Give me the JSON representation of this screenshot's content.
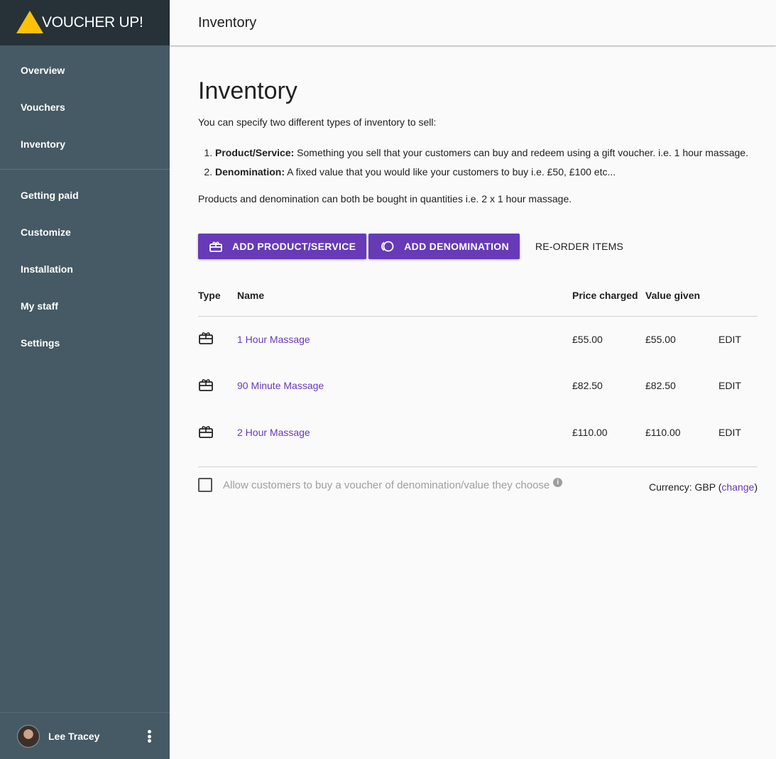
{
  "brand": {
    "name": "VOUCHER UP!"
  },
  "sidebar": {
    "items_top": [
      {
        "label": "Overview"
      },
      {
        "label": "Vouchers"
      },
      {
        "label": "Inventory"
      }
    ],
    "items_bottom": [
      {
        "label": "Getting paid"
      },
      {
        "label": "Customize"
      },
      {
        "label": "Installation"
      },
      {
        "label": "My staff"
      },
      {
        "label": "Settings"
      }
    ],
    "user": {
      "name": "Lee Tracey"
    }
  },
  "topbar": {
    "title": "Inventory"
  },
  "main": {
    "title": "Inventory",
    "intro": "You can specify two different types of inventory to sell:",
    "types": [
      {
        "term": "Product/Service:",
        "desc": " Something you sell that your customers can buy and redeem using a gift voucher. i.e. 1 hour massage."
      },
      {
        "term": "Denomination:",
        "desc": " A fixed value that you would like your customers to buy i.e. £50, £100 etc..."
      }
    ],
    "note": "Products and denomination can both be bought in quantities i.e. 2 x 1 hour massage.",
    "actions": {
      "add_product": "ADD PRODUCT/SERVICE",
      "add_denomination": "ADD DENOMINATION",
      "reorder": "RE-ORDER ITEMS"
    },
    "table": {
      "headers": {
        "type": "Type",
        "name": "Name",
        "price": "Price charged",
        "value": "Value given"
      },
      "rows": [
        {
          "type_icon": "gift-card-icon",
          "name": "1 Hour Massage",
          "price": "£55.00",
          "value": "£55.00",
          "action": "EDIT"
        },
        {
          "type_icon": "gift-card-icon",
          "name": "90 Minute Massage",
          "price": "£82.50",
          "value": "£82.50",
          "action": "EDIT"
        },
        {
          "type_icon": "gift-card-icon",
          "name": "2 Hour Massage",
          "price": "£110.00",
          "value": "£110.00",
          "action": "EDIT"
        }
      ]
    },
    "allow_custom": {
      "label": "Allow customers to buy a voucher of denomination/value they choose",
      "checked": false,
      "info_icon": "info-icon"
    },
    "currency": {
      "prefix": "Currency: GBP (",
      "link": "change",
      "suffix": ")"
    }
  },
  "colors": {
    "sidebar_bg": "#455a64",
    "brand_bg": "#263238",
    "accent": "#673ab7",
    "logo_yellow": "#ffc107"
  }
}
